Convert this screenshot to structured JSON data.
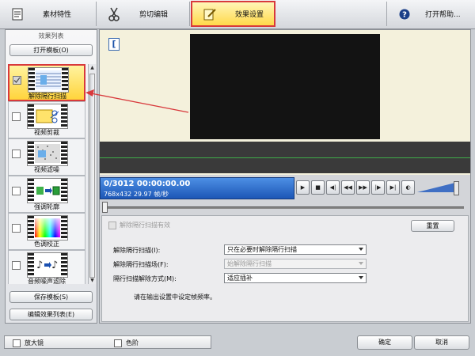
{
  "toolbar": {
    "tabs": [
      {
        "label": "素材特性",
        "icon": "document-icon"
      },
      {
        "label": "剪切编辑",
        "icon": "scissors-icon"
      },
      {
        "label": "效果设置",
        "icon": "edit-note-icon",
        "active": true
      },
      {
        "label": "打开帮助...",
        "icon": "help-icon"
      }
    ]
  },
  "left_panel": {
    "title": "效果列表",
    "open_template_button": "打开模板(O)",
    "save_template_button": "保存模板(S)",
    "edit_list_button": "编辑效果列表(E)",
    "effects": [
      {
        "label": "解除隔行扫描",
        "checked": true,
        "selected": true
      },
      {
        "label": "视频剪裁",
        "checked": false
      },
      {
        "label": "视频滤噪",
        "checked": false
      },
      {
        "label": "强调轮廓",
        "checked": false
      },
      {
        "label": "色调校正",
        "checked": false
      },
      {
        "label": "音频噪声滤除",
        "checked": false
      }
    ]
  },
  "preview": {
    "timecode": "0/3012  00:00:00.00",
    "info": "768x432 29.97 帧/秒"
  },
  "settings": {
    "enable_label": "解除隔行扫描有效",
    "reset_button": "重置",
    "rows": [
      {
        "label": "解除隔行扫描(I):",
        "value": "只在必要时解除隔行扫描",
        "disabled": false
      },
      {
        "label": "解除隔行扫描场(F):",
        "value": "始解除隔行扫描",
        "disabled": true
      },
      {
        "label": "隔行扫描解除方式(M):",
        "value": "适应插补",
        "disabled": false
      }
    ],
    "note": "请在输出设置中设定帧频率。"
  },
  "bottom": {
    "magnifier_label": "放大镜",
    "levels_label": "色阶",
    "ok_button": "确定",
    "cancel_button": "取消"
  },
  "colors": {
    "accent_yellow": "#ffd94a",
    "highlight_red": "#d8393c",
    "timecode_blue": "#1c56b6"
  }
}
